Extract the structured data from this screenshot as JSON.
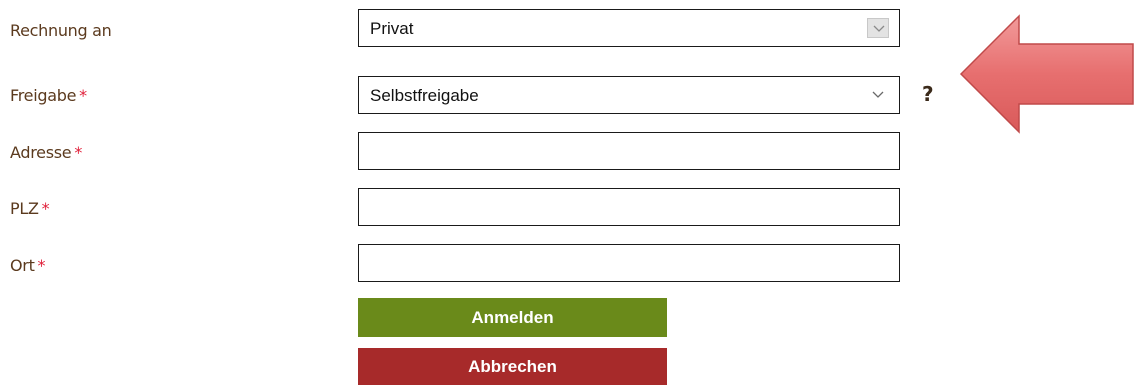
{
  "form": {
    "rechnung": {
      "label": "Rechnung an",
      "required": false,
      "value": "Privat"
    },
    "freigabe": {
      "label": "Freigabe",
      "required_mark": "*",
      "value": "Selbstfreigabe",
      "help": "?"
    },
    "adresse": {
      "label": "Adresse",
      "required_mark": "*",
      "value": ""
    },
    "plz": {
      "label": "PLZ",
      "required_mark": "*",
      "value": ""
    },
    "ort": {
      "label": "Ort",
      "required_mark": "*",
      "value": ""
    }
  },
  "buttons": {
    "submit_label": "Anmelden",
    "cancel_label": "Abbrechen"
  },
  "colors": {
    "label": "#5b3a1e",
    "required": "#e0203a",
    "submit": "#6a8a1a",
    "cancel": "#a72a2a",
    "annotation_arrow": "#e36a6a"
  },
  "icons": {
    "dropdown": "chevron-down-icon",
    "annotation": "arrow-left-icon"
  }
}
